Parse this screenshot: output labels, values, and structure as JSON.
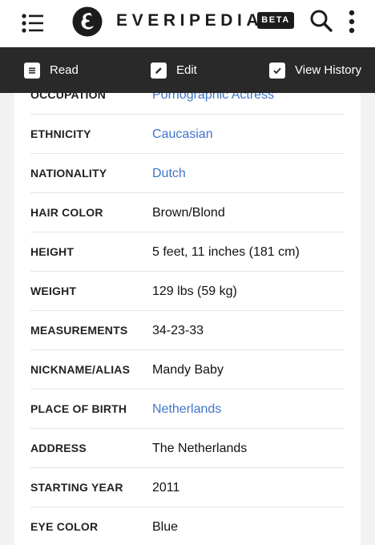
{
  "header": {
    "brand": "EVERIPEDIA",
    "badge": "BETA",
    "menu_icon": "hamburger-list-icon",
    "logo_icon": "everipedia-e-logo",
    "search_icon": "search-icon",
    "more_icon": "more-vertical-icon"
  },
  "toolbar": {
    "items": [
      {
        "label": "Read",
        "icon": "read-icon"
      },
      {
        "label": "Edit",
        "icon": "edit-icon"
      },
      {
        "label": "View History",
        "icon": "check-icon"
      }
    ]
  },
  "infobox": {
    "rows": [
      {
        "label": "OCCUPATION",
        "value": "Pornographic Actress",
        "link": true
      },
      {
        "label": "ETHNICITY",
        "value": "Caucasian",
        "link": true
      },
      {
        "label": "NATIONALITY",
        "value": "Dutch",
        "link": true
      },
      {
        "label": "HAIR COLOR",
        "value": "Brown/Blond",
        "link": false
      },
      {
        "label": "HEIGHT",
        "value": "5 feet, 11 inches (181 cm)",
        "link": false
      },
      {
        "label": "WEIGHT",
        "value": "129 lbs (59 kg)",
        "link": false
      },
      {
        "label": "MEASUREMENTS",
        "value": "34-23-33",
        "link": false
      },
      {
        "label": "NICKNAME/ALIAS",
        "value": "Mandy Baby",
        "link": false
      },
      {
        "label": "PLACE OF BIRTH",
        "value": "Netherlands",
        "link": true
      },
      {
        "label": "ADDRESS",
        "value": "The Netherlands",
        "link": false
      },
      {
        "label": "STARTING YEAR",
        "value": "2011",
        "link": false
      },
      {
        "label": "EYE COLOR",
        "value": "Blue",
        "link": false
      }
    ]
  },
  "colors": {
    "link": "#3f74c8",
    "toolbar_bg": "#292929",
    "page_bg": "#f2f2f2"
  }
}
